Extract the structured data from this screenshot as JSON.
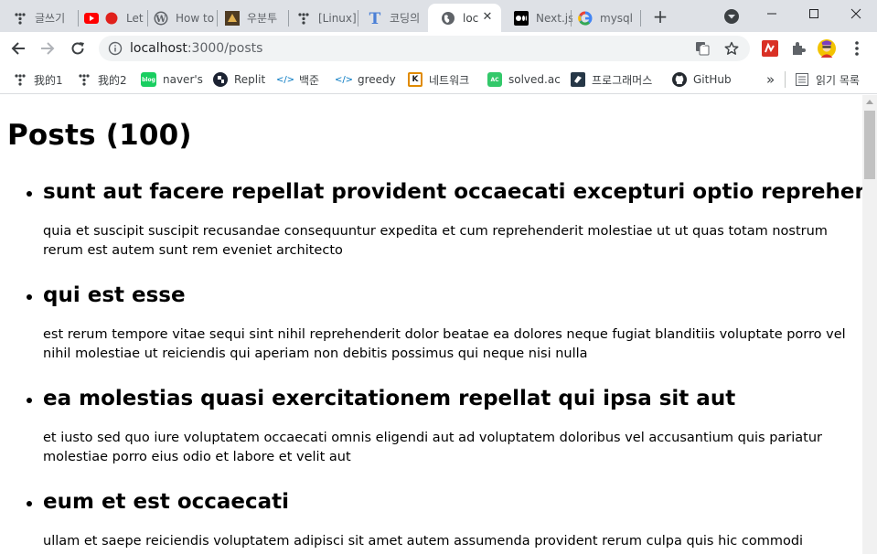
{
  "browser": {
    "tabs": [
      {
        "label": "글쓰기",
        "icon": "tistory-icon"
      },
      {
        "label": "Let",
        "icon": "youtube-icon"
      },
      {
        "label": "How to",
        "icon": "wordpress-icon"
      },
      {
        "label": "우분투",
        "icon": "ubuntu-icon"
      },
      {
        "label": "[Linux]",
        "icon": "tistory-icon"
      },
      {
        "label": "코딩의",
        "icon": "typora-icon"
      },
      {
        "label": "loc",
        "icon": "globe-icon",
        "active": true
      },
      {
        "label": "Next.js",
        "icon": "medium-icon"
      },
      {
        "label": "mysql",
        "icon": "google-icon"
      }
    ],
    "close_symbol": "✕",
    "new_tab_symbol": "+",
    "url": {
      "host": "localhost",
      "rest": ":3000/posts"
    },
    "bookmarks": [
      {
        "label": "我的1",
        "icon": "tistory-icon"
      },
      {
        "label": "我的2",
        "icon": "tistory-icon"
      },
      {
        "label": "naver's",
        "icon": "naver-blog-icon",
        "badge": "blog"
      },
      {
        "label": "Replit",
        "icon": "replit-icon"
      },
      {
        "label": "백준",
        "icon": "code-brackets-icon",
        "badge": "</>"
      },
      {
        "label": "greedy",
        "icon": "code-brackets-icon",
        "badge": "</>"
      },
      {
        "label": "네트워크",
        "icon": "k-icon",
        "badge": "K"
      },
      {
        "label": "solved.ac",
        "icon": "solved-ac-icon",
        "badge": "AC"
      },
      {
        "label": "프로그래머스",
        "icon": "programmers-icon"
      },
      {
        "label": "GitHub",
        "icon": "github-icon"
      }
    ],
    "overflow_symbol": "»",
    "reading_list_label": "읽기 목록",
    "colors": {
      "tabstrip": "#dee1e6",
      "omnibox": "#f1f3f4",
      "youtube_red": "#ff0000"
    }
  },
  "page": {
    "title": "Posts (100)",
    "posts": [
      {
        "title": "sunt aut facere repellat provident occaecati excepturi optio reprehenderit",
        "body": "quia et suscipit suscipit recusandae consequuntur expedita et cum reprehenderit molestiae ut ut quas totam nostrum rerum est autem sunt rem eveniet architecto"
      },
      {
        "title": "qui est esse",
        "body": "est rerum tempore vitae sequi sint nihil reprehenderit dolor beatae ea dolores neque fugiat blanditiis voluptate porro vel nihil molestiae ut reiciendis qui aperiam non debitis possimus qui neque nisi nulla"
      },
      {
        "title": "ea molestias quasi exercitationem repellat qui ipsa sit aut",
        "body": "et iusto sed quo iure voluptatem occaecati omnis eligendi aut ad voluptatem doloribus vel accusantium quis pariatur molestiae porro eius odio et labore et velit aut"
      },
      {
        "title": "eum et est occaecati",
        "body": "ullam et saepe reiciendis voluptatem adipisci sit amet autem assumenda provident rerum culpa quis hic commodi"
      }
    ]
  }
}
